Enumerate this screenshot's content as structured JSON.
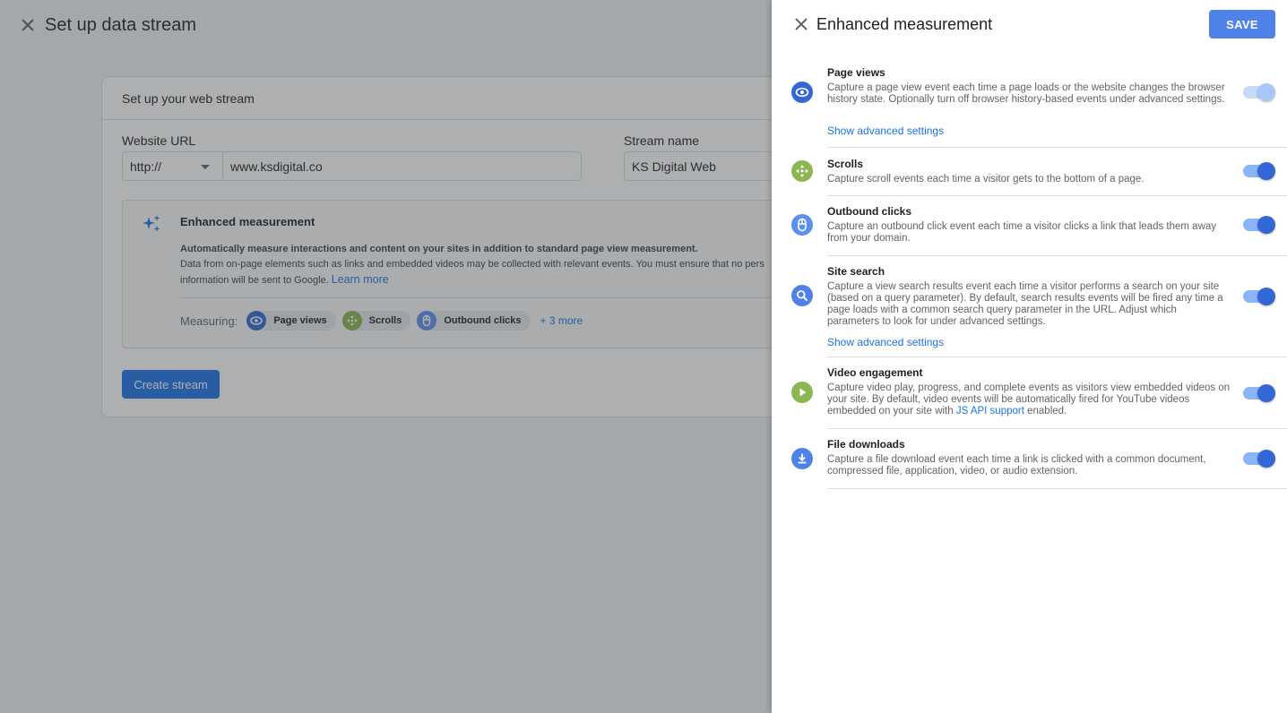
{
  "background": {
    "title": "Set up data stream",
    "card_title": "Set up your web stream",
    "website_url_label": "Website URL",
    "protocol": "http://",
    "url_value": "www.ksdigital.co",
    "stream_name_label": "Stream name",
    "stream_name_value": "KS Digital Web",
    "em_title": "Enhanced measurement",
    "em_desc_bold": "Automatically measure interactions and content on your sites in addition to standard page view measurement.",
    "em_desc_line2": "Data from on-page elements such as links and embedded videos may be collected with relevant events. You must ensure that no pers",
    "em_desc_line3": "information will be sent to Google.",
    "learn_more": "Learn more",
    "measuring_label": "Measuring:",
    "chips": [
      {
        "label": "Page views",
        "icon": "eye-icon",
        "color": "#3367d6"
      },
      {
        "label": "Scrolls",
        "icon": "scroll-icon",
        "color": "#8bb652"
      },
      {
        "label": "Outbound clicks",
        "icon": "mouse-icon",
        "color": "#5b8ff0"
      }
    ],
    "more_link": "+ 3 more",
    "create_button": "Create stream"
  },
  "panel": {
    "title": "Enhanced measurement",
    "save_label": "SAVE",
    "items": [
      {
        "title": "Page views",
        "desc": "Capture a page view event each time a page loads or the website changes the browser history state. Optionally turn off browser history-based events under advanced settings.",
        "advanced": "Show advanced settings",
        "icon": "eye-icon",
        "icon_color": "#3367d6",
        "enabled": true,
        "locked": true
      },
      {
        "title": "Scrolls",
        "desc": "Capture scroll events each time a visitor gets to the bottom of a page.",
        "icon": "scroll-icon",
        "icon_color": "#8bb652",
        "enabled": true
      },
      {
        "title": "Outbound clicks",
        "desc": "Capture an outbound click event each time a visitor clicks a link that leads them away from your domain.",
        "icon": "mouse-icon",
        "icon_color": "#5b8ff0",
        "enabled": true
      },
      {
        "title": "Site search",
        "desc": "Capture a view search results event each time a visitor performs a search on your site (based on a query parameter). By default, search results events will be fired any time a page loads with a common search query parameter in the URL. Adjust which parameters to look for under advanced settings.",
        "advanced": "Show advanced settings",
        "icon": "search-icon",
        "icon_color": "#4e82e8",
        "enabled": true
      },
      {
        "title": "Video engagement",
        "desc_before": "Capture video play, progress, and complete events as visitors view embedded videos on your site. By default, video events will be automatically fired for YouTube videos embedded on your site with",
        "desc_link": "JS API support",
        "desc_after": "enabled.",
        "icon": "play-icon",
        "icon_color": "#8bb652",
        "enabled": true
      },
      {
        "title": "File downloads",
        "desc": "Capture a file download event each time a link is clicked with a common document, compressed file, application, video, or audio extension.",
        "icon": "download-icon",
        "icon_color": "#4e82e8",
        "enabled": true
      }
    ]
  }
}
